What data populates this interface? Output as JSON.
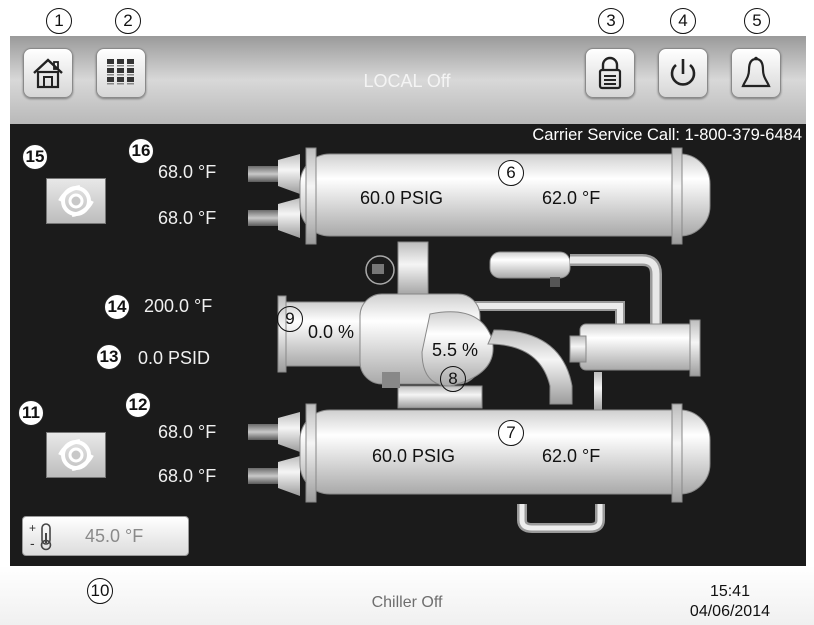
{
  "header": {
    "title": "LOCAL Off",
    "buttons": [
      "home",
      "menu",
      "login",
      "start-stop",
      "alarm"
    ]
  },
  "service_call": "Carrier Service Call: 1-800-379-6484",
  "condenser": {
    "entering_temp": "68.0 °F",
    "leaving_temp": "68.0 °F",
    "pressure": "60.0 PSIG",
    "temperature": "62.0 °F"
  },
  "evaporator": {
    "entering_temp": "68.0 °F",
    "leaving_temp": "68.0 °F",
    "pressure": "60.0 PSIG",
    "temperature": "62.0 °F"
  },
  "compressor": {
    "discharge_temp": "200.0 °F",
    "oil_pressure": "0.0 PSID",
    "guide_vane": "0.0 %",
    "motor_load": "5.5 %"
  },
  "setpoint": {
    "value": "45.0 °F"
  },
  "status_bar": {
    "status": "Chiller Off",
    "time": "15:41",
    "date": "04/06/2014"
  },
  "callouts": {
    "c1": "1",
    "c2": "2",
    "c3": "3",
    "c4": "4",
    "c5": "5",
    "c6": "6",
    "c7": "7",
    "c8": "8",
    "c9": "9",
    "c10": "10",
    "c11": "11",
    "c12": "12",
    "c13": "13",
    "c14": "14",
    "c15": "15",
    "c16": "16"
  },
  "colors": {
    "background": "#1b1b1b",
    "vessel": "#e6e6e6",
    "topbar": "#b0b0b0"
  }
}
